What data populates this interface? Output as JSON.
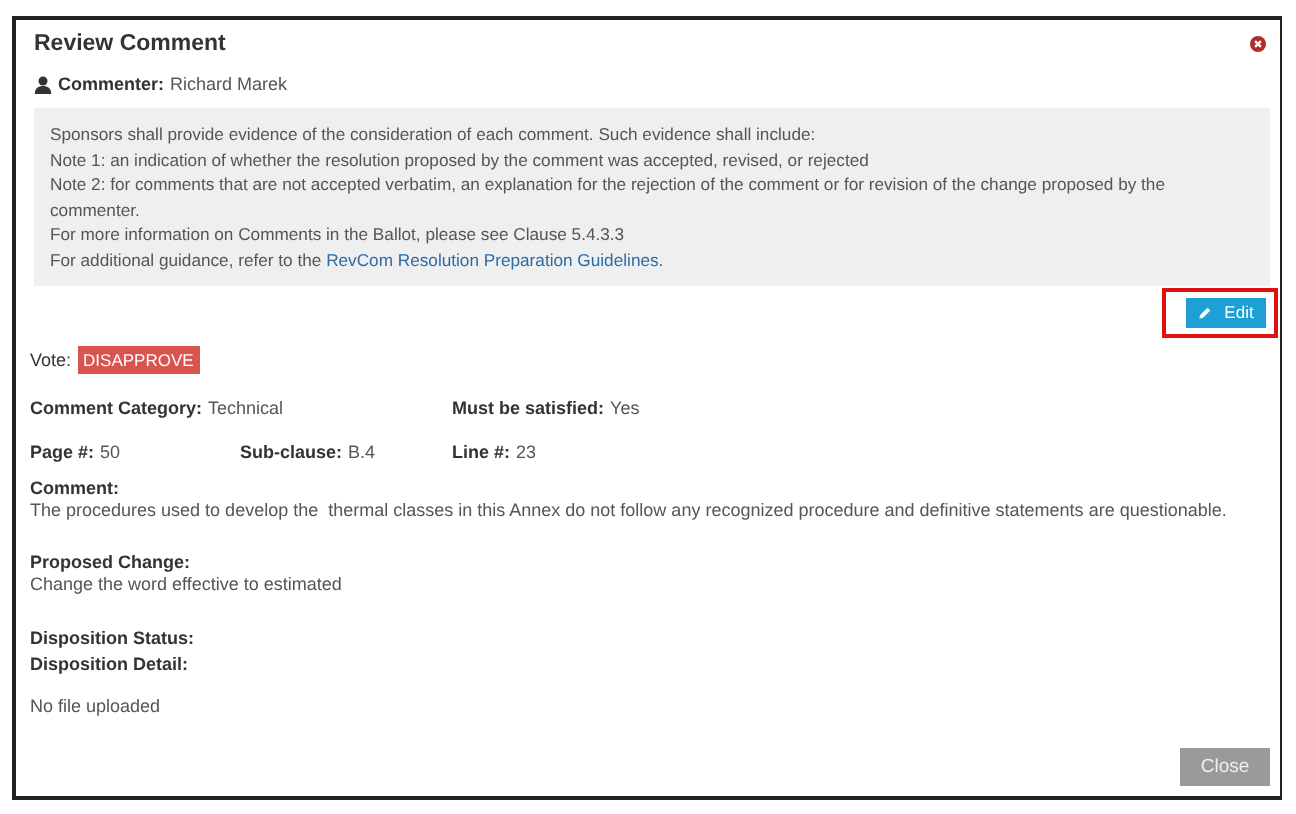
{
  "window": {
    "title": "Review Comment"
  },
  "commenter": {
    "label": "Commenter:",
    "value": "Richard Marek"
  },
  "guidance": [
    {
      "text": "Sponsors shall provide evidence of the consideration of each comment. Such evidence shall include:"
    },
    {
      "text": "Note 1: an indication of whether the resolution proposed by the comment was accepted, revised, or rejected"
    },
    {
      "text": "Note 2: for comments that are not accepted verbatim, an explanation for the rejection of the comment or for revision of the change proposed by the commenter."
    },
    {
      "text": "For more information on Comments in the Ballot, please see Clause 5.4.3.3"
    },
    {
      "text": "For additional guidance, refer to the ",
      "link": "RevCom Resolution Preparation Guidelines",
      "suffix": "."
    }
  ],
  "edit_button": {
    "label": "Edit",
    "highlighted": true
  },
  "vote": {
    "label": "Vote:",
    "value": "DISAPPROVE"
  },
  "field_rows": [
    [
      {
        "label": "Comment Category:",
        "value": "Technical"
      },
      {
        "label": "Must be satisfied:",
        "value": "Yes"
      }
    ],
    [
      {
        "label": "Page #:",
        "value": "50"
      },
      {
        "label": "Sub-clause:",
        "value": "B.4"
      },
      {
        "label": "Line #:",
        "value": "23"
      }
    ]
  ],
  "comment": {
    "label": "Comment:",
    "value": "The procedures used to develop the  thermal classes in this Annex do not follow any recognized procedure and definitive statements are questionable."
  },
  "proposed_change": {
    "label": "Proposed Change:",
    "value": "Change the word effective to estimated"
  },
  "disposition": [
    {
      "label": "Disposition Status:"
    },
    {
      "label": "Disposition Detail:"
    }
  ],
  "attachment_note": "No file uploaded",
  "close_button": {
    "label": "Close"
  }
}
